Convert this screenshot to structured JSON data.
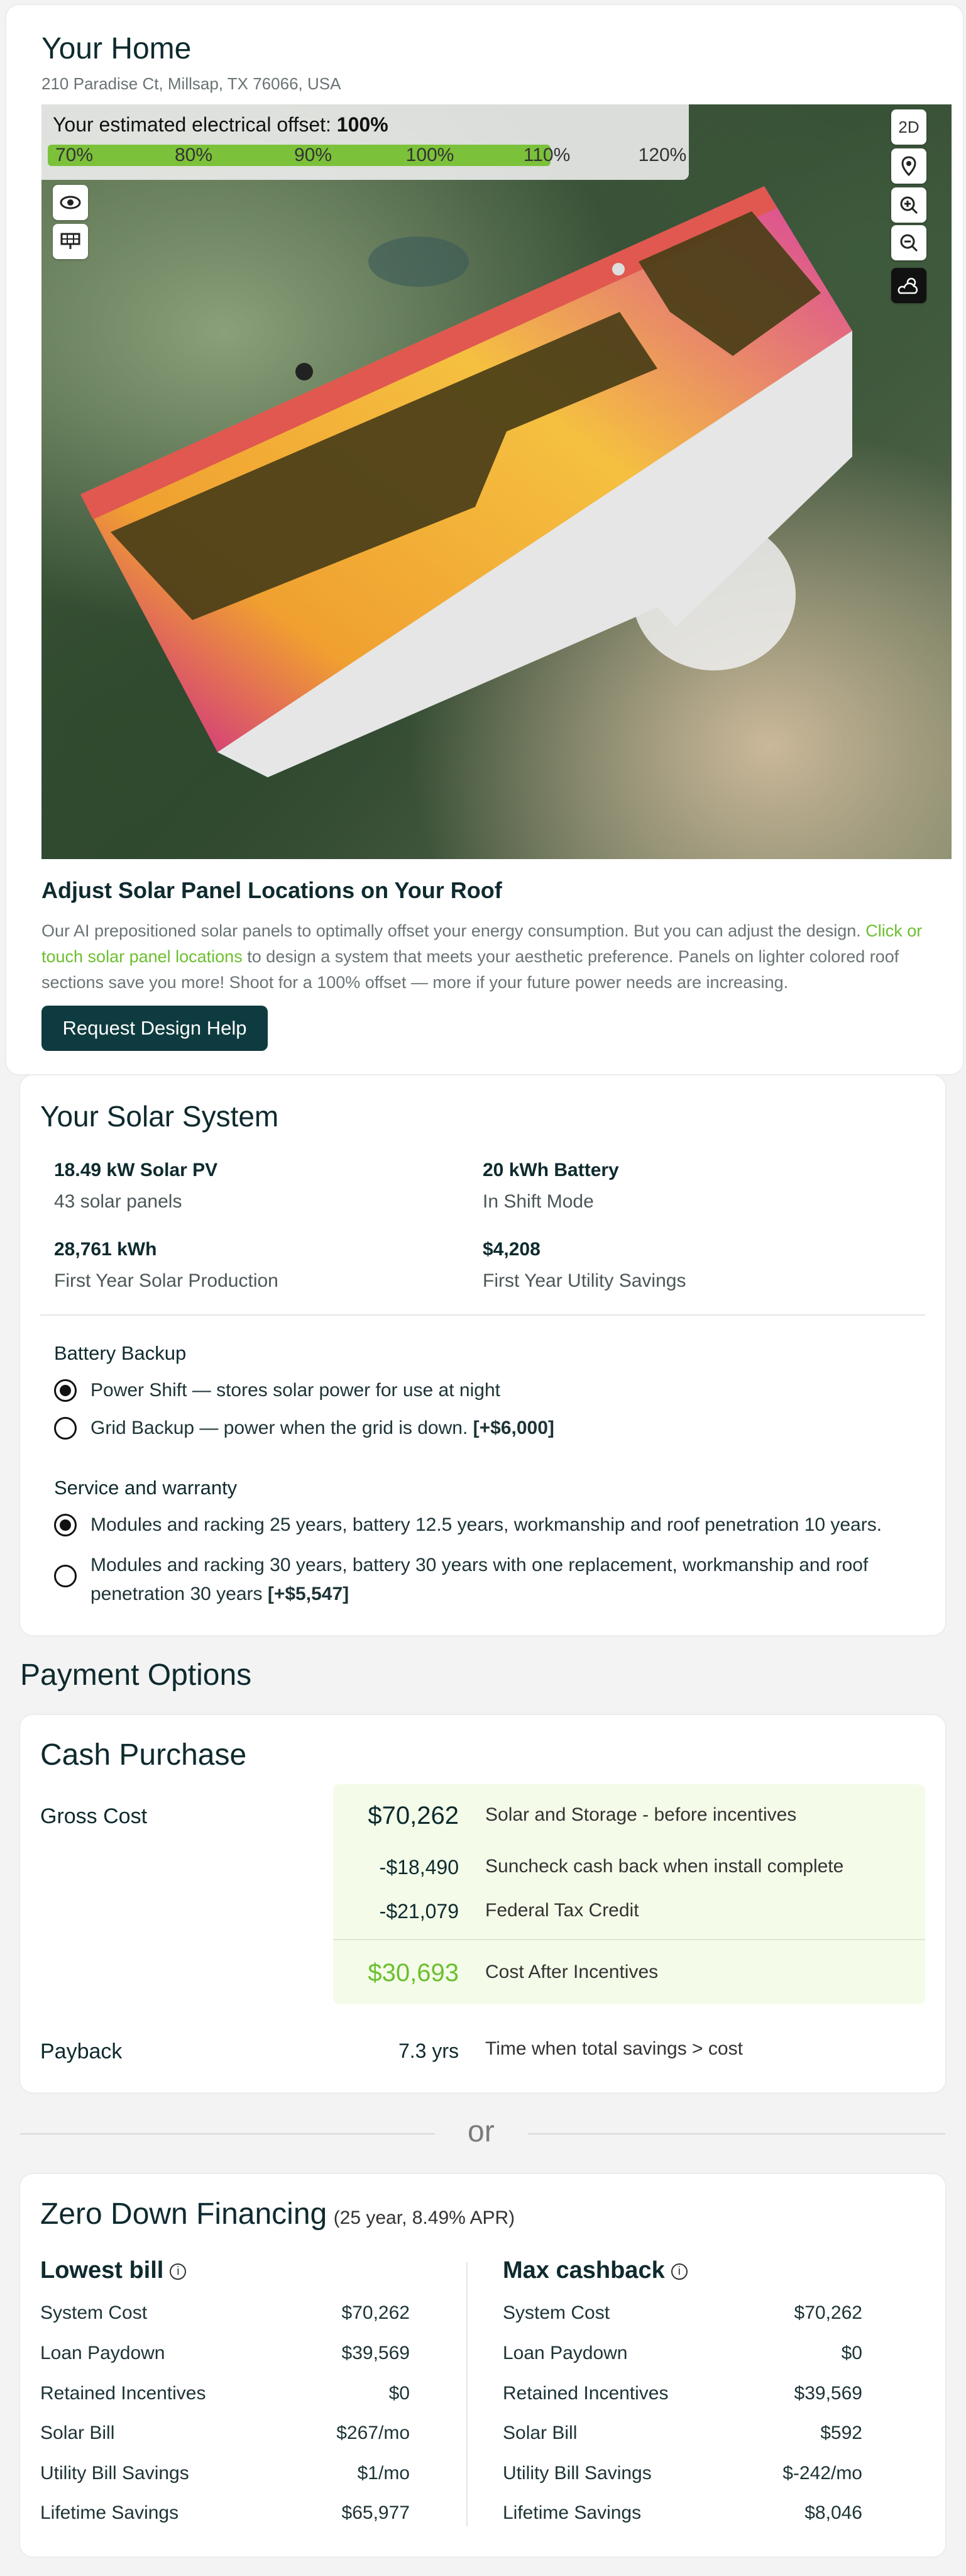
{
  "home": {
    "title": "Your Home",
    "address": "210 Paradise Ct, Millsap, TX 76066, USA",
    "offset": {
      "label_prefix": "Your estimated electrical offset: ",
      "value": "100%",
      "fill_fraction": 0.8,
      "ticks": [
        "70%",
        "80%",
        "90%",
        "100%",
        "110%",
        "120%"
      ]
    },
    "map_buttons": {
      "view_2d": "2D"
    },
    "adjust_title": "Adjust Solar Panel Locations on Your Roof",
    "adjust_body_1": "Our AI prepositioned solar panels to optimally offset your energy consumption. But you can adjust the design. ",
    "adjust_link": "Click or touch solar panel locations",
    "adjust_body_2": " to design a system that meets your aesthetic preference. Panels on lighter colored roof sections save you more! Shoot for a 100% offset — more if your future power needs are increasing.",
    "request_button": "Request Design Help"
  },
  "solar": {
    "title": "Your Solar System",
    "stats": [
      {
        "value": "18.49 kW Solar PV",
        "label": "43 solar panels"
      },
      {
        "value": "20 kWh Battery",
        "label": "In Shift Mode"
      },
      {
        "value": "28,761 kWh",
        "label": "First Year Solar Production"
      },
      {
        "value": "$4,208",
        "label": "First Year Utility Savings"
      }
    ],
    "battery_backup": {
      "heading": "Battery Backup",
      "options": [
        {
          "text": "Power Shift — stores solar power for use at night",
          "extra": "",
          "selected": true
        },
        {
          "text": "Grid Backup — power when the grid is down. ",
          "extra": "[+$6,000]",
          "selected": false
        }
      ]
    },
    "warranty": {
      "heading": "Service and warranty",
      "options": [
        {
          "text": "Modules and racking 25 years, battery 12.5 years, workmanship and roof penetration 10 years.",
          "extra": "",
          "selected": true
        },
        {
          "text": "Modules and racking 30 years, battery 30 years with one replacement, workmanship and roof penetration 30 years ",
          "extra": "[+$5,547]",
          "selected": false
        }
      ]
    }
  },
  "payment": {
    "title": "Payment Options",
    "cash": {
      "title": "Cash Purchase",
      "gross_label": "Gross Cost",
      "rows": [
        {
          "amount": "$70,262",
          "desc": "Solar and Storage - before incentives"
        },
        {
          "amount": "-$18,490",
          "desc": "Suncheck cash back when install complete"
        },
        {
          "amount": "-$21,079",
          "desc": "Federal Tax Credit"
        }
      ],
      "net": {
        "amount": "$30,693",
        "desc": "Cost After Incentives"
      },
      "payback_label": "Payback",
      "payback_value": "7.3 yrs",
      "payback_desc": "Time when total savings > cost"
    },
    "or": "or",
    "financing": {
      "title": "Zero Down Financing",
      "subtitle": "(25 year, 8.49% APR)",
      "columns": [
        {
          "heading": "Lowest bill",
          "rows": [
            {
              "label": "System Cost",
              "value": "$70,262",
              "green": false
            },
            {
              "label": "Loan Paydown",
              "value": "$39,569",
              "green": false
            },
            {
              "label": "Retained Incentives",
              "value": "$0",
              "green": false
            },
            {
              "label": "Solar Bill",
              "value": "$267/mo",
              "green": false
            },
            {
              "label": "Utility Bill Savings",
              "value": "$1/mo",
              "green": true
            },
            {
              "label": "Lifetime Savings",
              "value": "$65,977",
              "green": false
            }
          ]
        },
        {
          "heading": "Max cashback",
          "rows": [
            {
              "label": "System Cost",
              "value": "$70,262",
              "green": false
            },
            {
              "label": "Loan Paydown",
              "value": "$0",
              "green": false
            },
            {
              "label": "Retained Incentives",
              "value": "$39,569",
              "green": true
            },
            {
              "label": "Solar Bill",
              "value": "$592",
              "green": false
            },
            {
              "label": "Utility Bill Savings",
              "value": "$-242/mo",
              "green": false
            },
            {
              "label": "Lifetime Savings",
              "value": "$8,046",
              "green": false
            }
          ]
        }
      ]
    }
  },
  "colors": {
    "accent_green": "#6cbf2e",
    "button_dark": "#0e3b3f",
    "incentive_bg": "#f4fce9"
  }
}
